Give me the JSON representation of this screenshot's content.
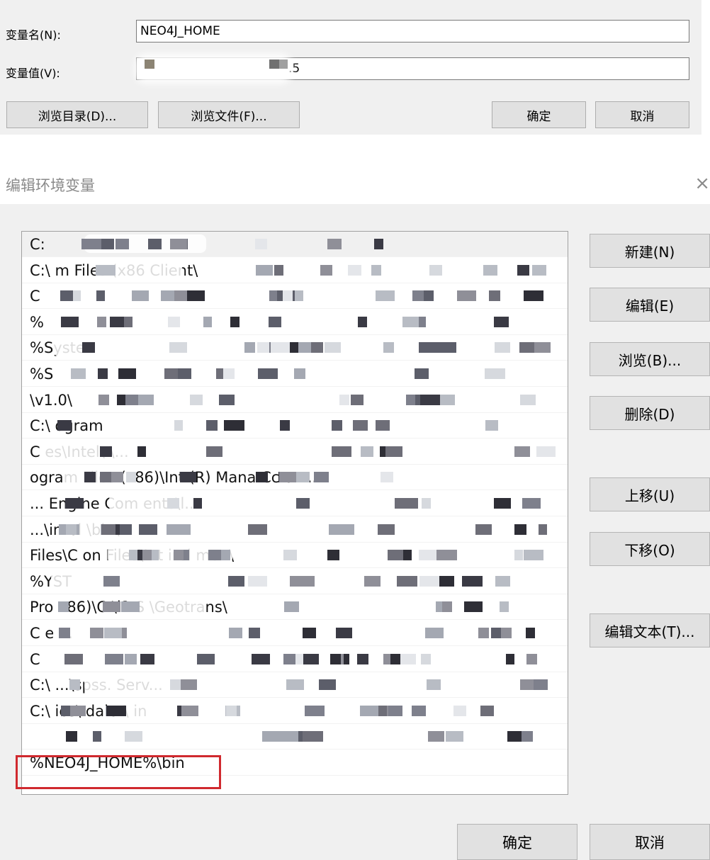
{
  "var_dialog": {
    "name_label": "变量名(N):",
    "name_value": "NEO4J_HOME",
    "value_label": "变量值(V):",
    "value_visible_suffix": ".5",
    "browse_dir_label": "浏览目录(D)...",
    "browse_file_label": "浏览文件(F)...",
    "ok_label": "确定",
    "cancel_label": "取消"
  },
  "env_dialog": {
    "title": "编辑环境变量",
    "close_glyph": "×",
    "buttons": {
      "new": "新建(N)",
      "edit": "编辑(E)",
      "browse": "浏览(B)...",
      "delete": "删除(D)",
      "move_up": "上移(U)",
      "move_down": "下移(O)",
      "edit_text": "编辑文本(T)..."
    },
    "path_rows": [
      "C:",
      "C:\\        m Files (x86               Client\\",
      "C",
      "%",
      "%Syste",
      "%S",
      "                                                           \\v1.0\\",
      "C:\\   ogram",
      "C            es\\Intel\\                                                     \\...",
      "        ogram Files (x86)\\Int              (R) Mana                            Cc        on...",
      "                                                    ... Engine Com          ents\\l...",
      "                     ...\\intel       \\bin\\",
      "             Files\\C         on Files\\Int           irel                mon\\",
      "%YST",
      "     Pro                  x86)\\C                        \\i2 S            \\Geotrans\\",
      "C     e                                                                                        ...",
      "C",
      "C:\\                                                          ...\\spss.                 Serv...",
      "C:\\                ies\\                     daler\\                          in",
      "",
      "%NEO4J_HOME%\\bin"
    ],
    "ok_label": "确定",
    "cancel_label": "取消"
  },
  "colors": {
    "dialog_bg": "#f0f0f0",
    "button_bg": "#e1e1e1",
    "highlight_red": "#d0292e",
    "title_gray": "#8a8a8a"
  }
}
